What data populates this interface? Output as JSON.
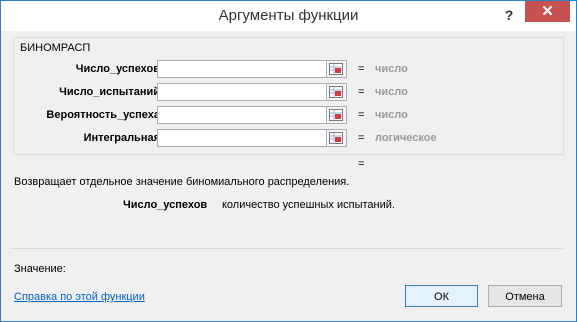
{
  "window": {
    "title": "Аргументы функции",
    "help": "?",
    "close": "✕"
  },
  "function_name": "БИНОМРАСП",
  "arguments": [
    {
      "label": "Число_успехов",
      "value": "",
      "equals": "=",
      "hint": "число"
    },
    {
      "label": "Число_испытаний",
      "value": "",
      "equals": "=",
      "hint": "число"
    },
    {
      "label": "Вероятность_успеха",
      "value": "",
      "equals": "=",
      "hint": "число"
    },
    {
      "label": "Интегральная",
      "value": "",
      "equals": "=",
      "hint": "логическое"
    }
  ],
  "result_equals": "=",
  "description": "Возвращает отдельное значение биномиального распределения.",
  "arg_help": {
    "name": "Число_успехов",
    "text": "количество успешных испытаний."
  },
  "value_label": "Значение:",
  "help_link": "Справка по этой функции",
  "buttons": {
    "ok": "ОК",
    "cancel": "Отмена"
  },
  "colors": {
    "close_button": "#c75050",
    "hint_text": "#9a9a9a",
    "link": "#0563c1",
    "border": "#2f7fc8"
  }
}
